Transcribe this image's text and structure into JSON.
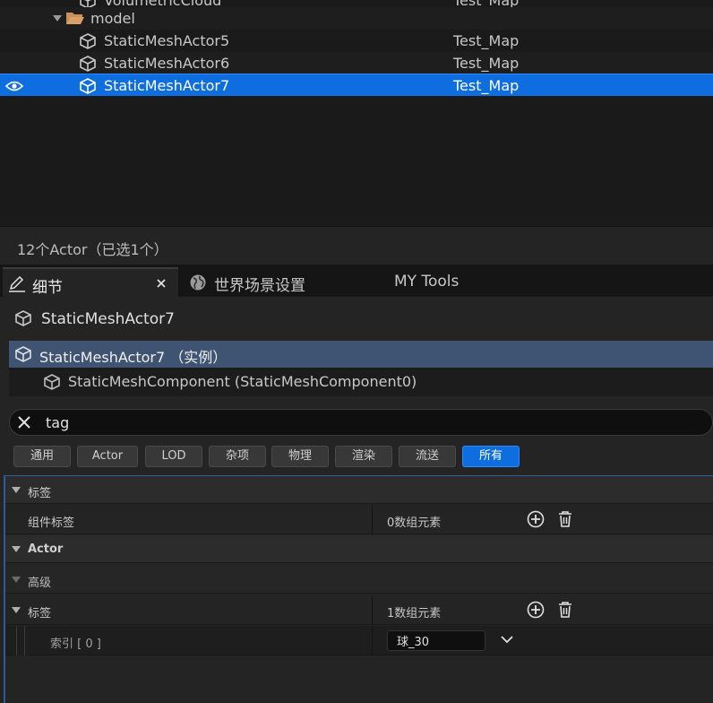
{
  "outliner": {
    "rows": [
      {
        "label": "VolumetricCloud",
        "type": "Test_Map"
      },
      {
        "label": "model"
      },
      {
        "label": "StaticMeshActor5",
        "type": "Test_Map"
      },
      {
        "label": "StaticMeshActor6",
        "type": "Test_Map"
      },
      {
        "label": "StaticMeshActor7",
        "type": "Test_Map"
      }
    ],
    "footer": "12个Actor（已选1个）"
  },
  "tabs": [
    {
      "label": "细节"
    },
    {
      "label": "世界场景设置"
    },
    {
      "label": "MY Tools"
    }
  ],
  "details": {
    "actor_name": "StaticMeshActor7",
    "hierarchy": {
      "instance": "StaticMeshActor7 （实例）",
      "component": "StaticMeshComponent (StaticMeshComponent0)"
    },
    "search": {
      "value": "tag"
    },
    "filters": [
      "通用",
      "Actor",
      "LOD",
      "杂项",
      "物理",
      "渲染",
      "流送",
      "所有"
    ],
    "active_filter": "所有",
    "sections": {
      "tags_cat": "标签",
      "component_tags": {
        "name": "组件标签",
        "value": "0数组元素"
      },
      "actor_cat": "Actor",
      "advanced_cat": "高级",
      "tags": {
        "name": "标签",
        "value": "1数组元素"
      },
      "index0": {
        "name": "索引 [ 0 ]",
        "value": "球_30"
      }
    }
  },
  "colors": {
    "accent": "#0e6ee0",
    "selection_row": "#3f5472",
    "folder": "#c8915a"
  }
}
